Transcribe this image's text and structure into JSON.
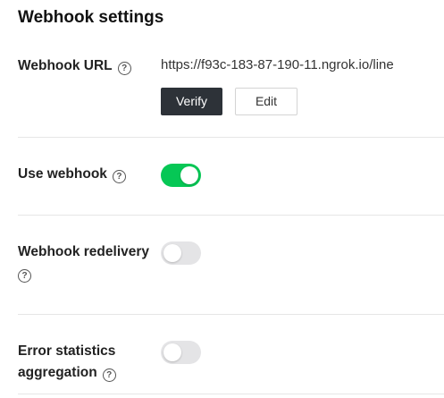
{
  "header": {
    "title": "Webhook settings"
  },
  "webhook_url": {
    "label": "Webhook URL",
    "value": "https://f93c-183-87-190-11.ngrok.io/line",
    "verify_label": "Verify",
    "edit_label": "Edit"
  },
  "use_webhook": {
    "label": "Use webhook",
    "enabled": true
  },
  "webhook_redelivery": {
    "label": "Webhook redelivery",
    "enabled": false
  },
  "error_statistics": {
    "label_line1": "Error statistics",
    "label_line2": "aggregation",
    "enabled": false
  },
  "icons": {
    "help": "?"
  },
  "colors": {
    "toggle_on": "#06c755",
    "toggle_off": "#e4e4e6",
    "primary_button": "#2d3238"
  }
}
